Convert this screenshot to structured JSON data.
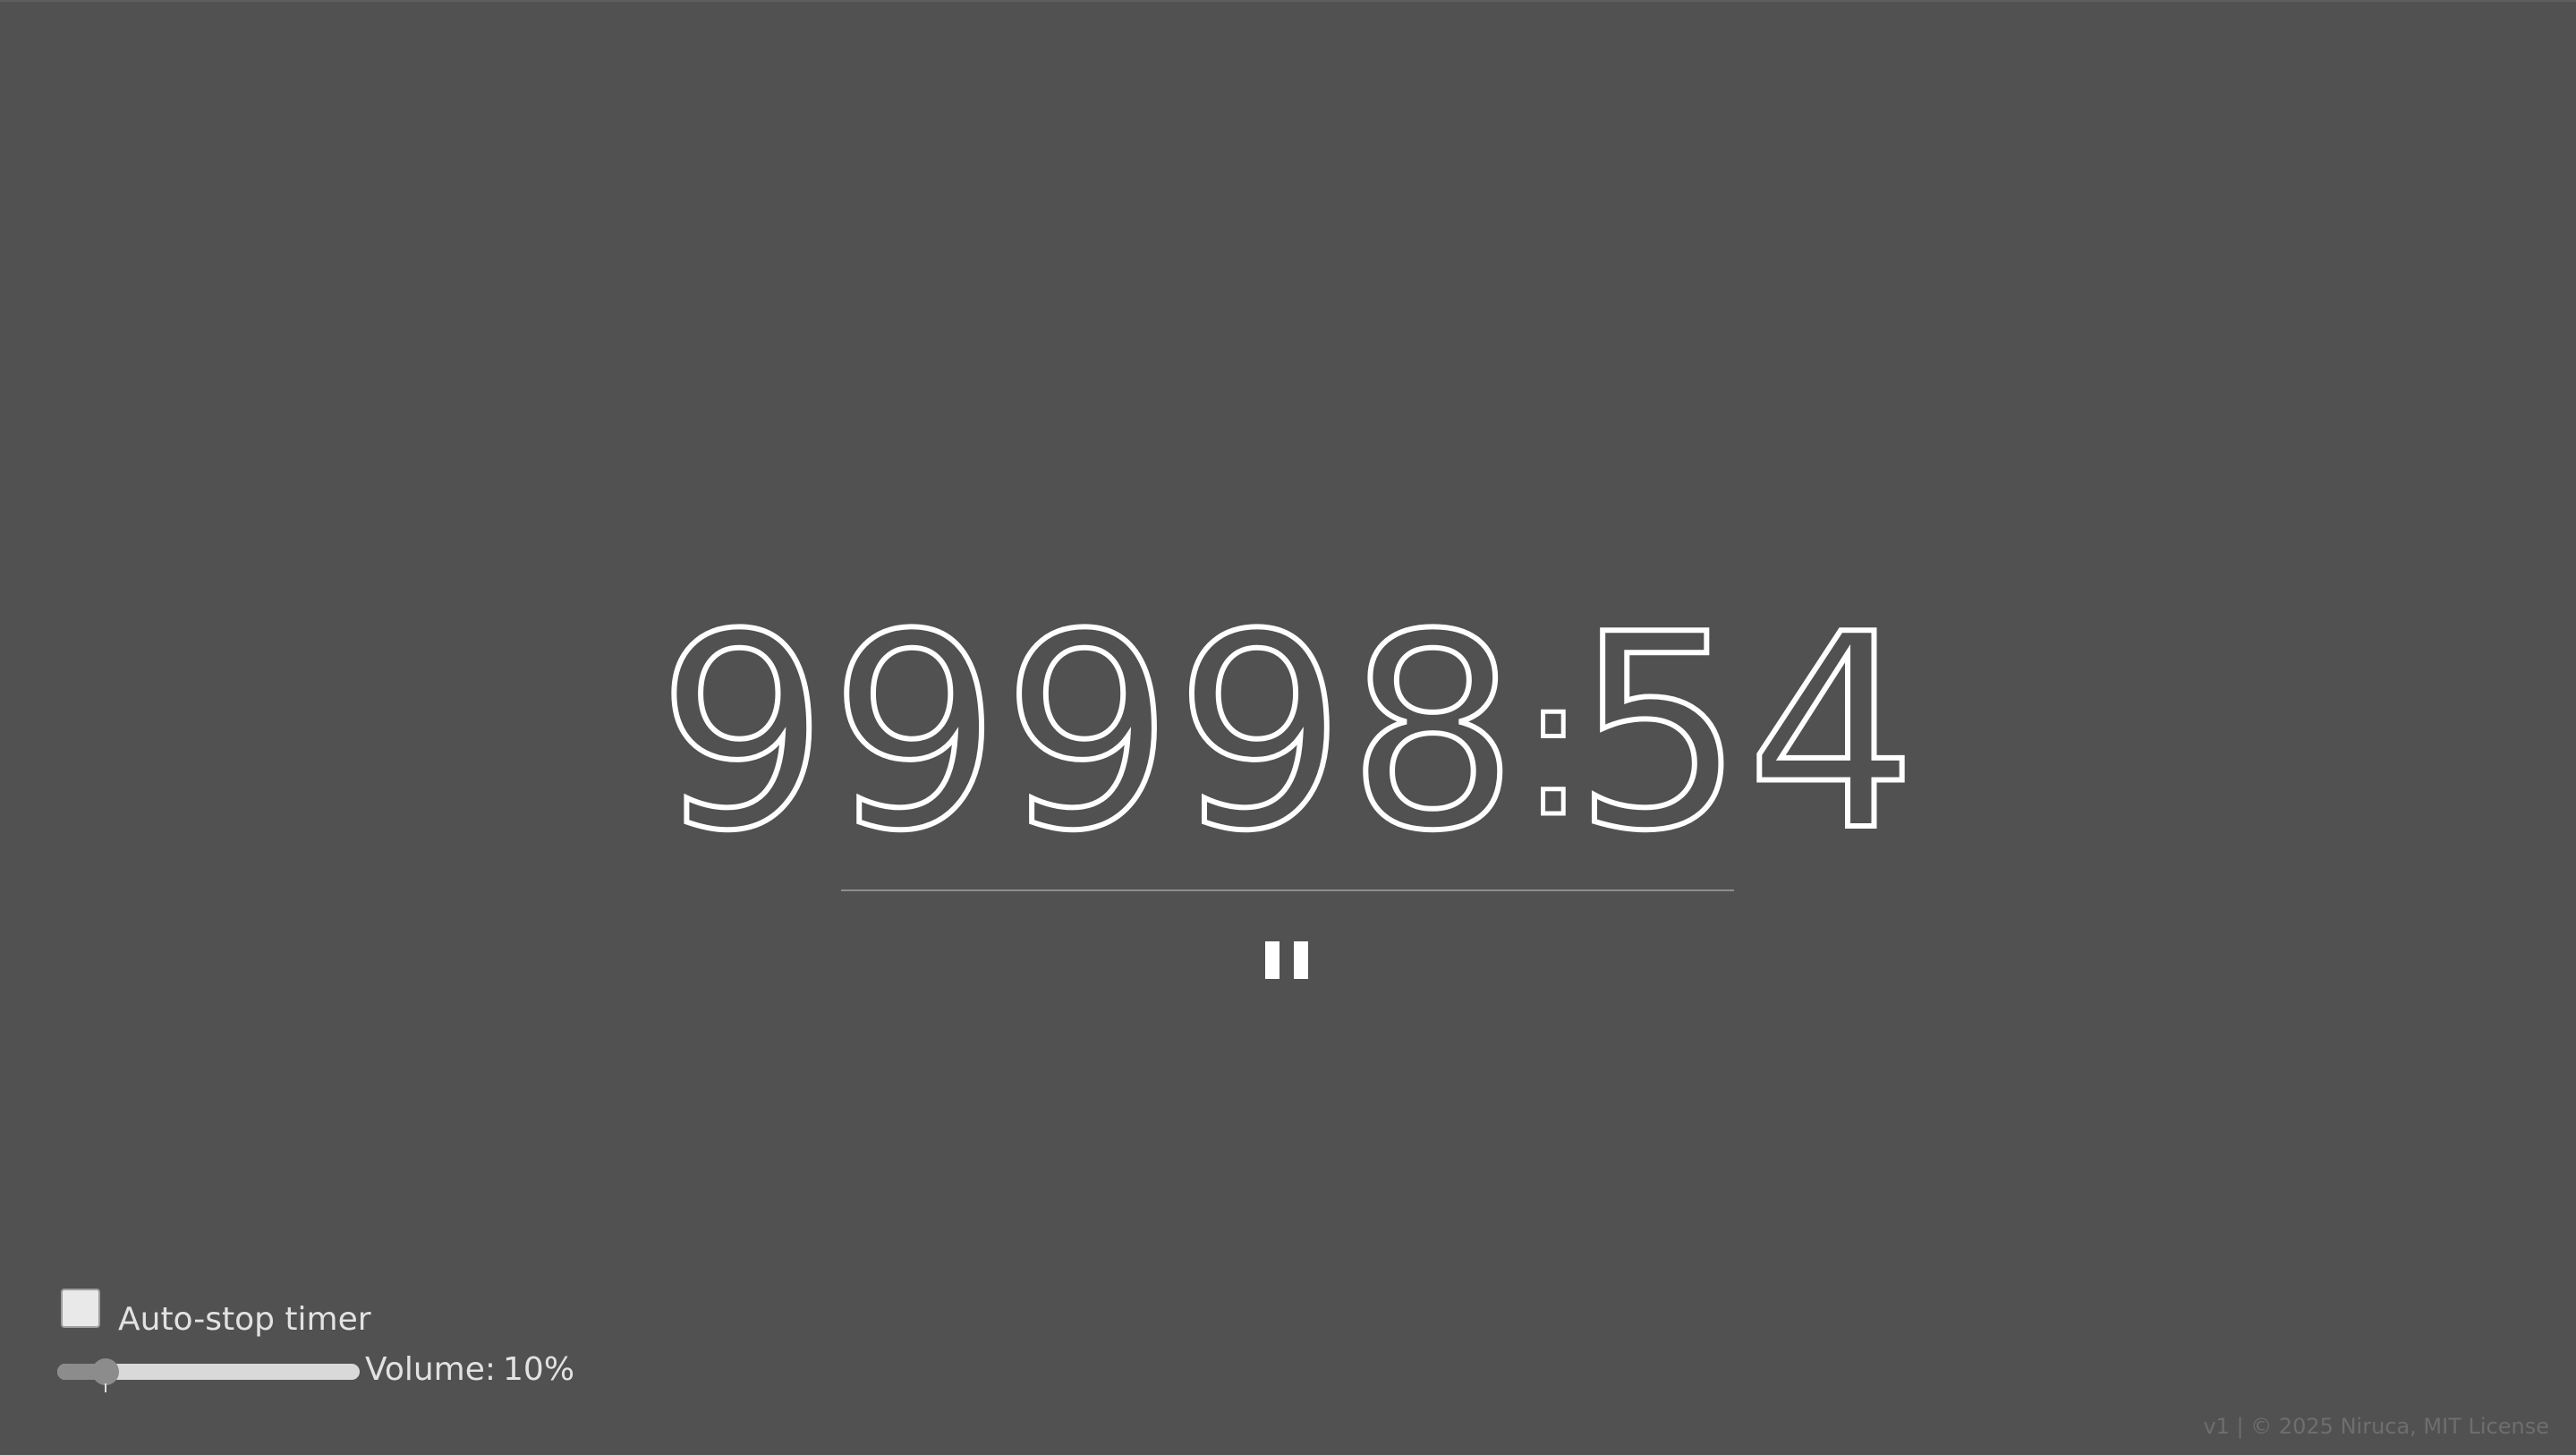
{
  "timer": {
    "minutes": "99998",
    "separator": ":",
    "seconds": "54"
  },
  "controls": {
    "pause_icon": "pause-icon",
    "auto_stop": {
      "label": "Auto-stop timer",
      "checked": false
    },
    "volume": {
      "label": "Volume:",
      "value_text": "10%",
      "level": 0.1
    }
  },
  "footer": {
    "text": "v1 | © 2025 Niruca, MIT License"
  },
  "colors": {
    "background": "#515151",
    "foreground": "#ffffff",
    "muted": "#6e6e6e"
  }
}
